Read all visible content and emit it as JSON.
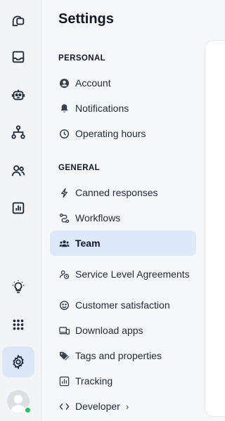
{
  "settings": {
    "title": "Settings",
    "sections": [
      {
        "title": "PERSONAL",
        "items": [
          {
            "label": "Account",
            "icon": "account-icon"
          },
          {
            "label": "Notifications",
            "icon": "bell-icon"
          },
          {
            "label": "Operating hours",
            "icon": "clock-icon"
          }
        ]
      },
      {
        "title": "GENERAL",
        "items": [
          {
            "label": "Canned responses",
            "icon": "lightning-icon"
          },
          {
            "label": "Workflows",
            "icon": "workflow-icon"
          },
          {
            "label": "Team",
            "icon": "team-icon",
            "active": true
          },
          {
            "label": "Service Level Agreements",
            "icon": "sla-icon"
          },
          {
            "label": "Customer satisfaction",
            "icon": "smiley-icon"
          },
          {
            "label": "Download apps",
            "icon": "devices-icon"
          },
          {
            "label": "Tags and properties",
            "icon": "tag-icon"
          },
          {
            "label": "Tracking",
            "icon": "chart-icon"
          },
          {
            "label": "Developer",
            "icon": "code-icon",
            "has_chevron": true
          }
        ]
      }
    ]
  },
  "rail": {
    "items": [
      "chats-icon",
      "inbox-icon",
      "bot-icon",
      "org-chart-icon",
      "contacts-icon",
      "reports-icon",
      "lightbulb-icon",
      "apps-grid-icon",
      "gear-icon"
    ],
    "active": "gear-icon",
    "status_color": "#22c55e"
  },
  "colors": {
    "active_bg": "#dde8f9",
    "rail_active_bg": "#dbe6f7"
  }
}
